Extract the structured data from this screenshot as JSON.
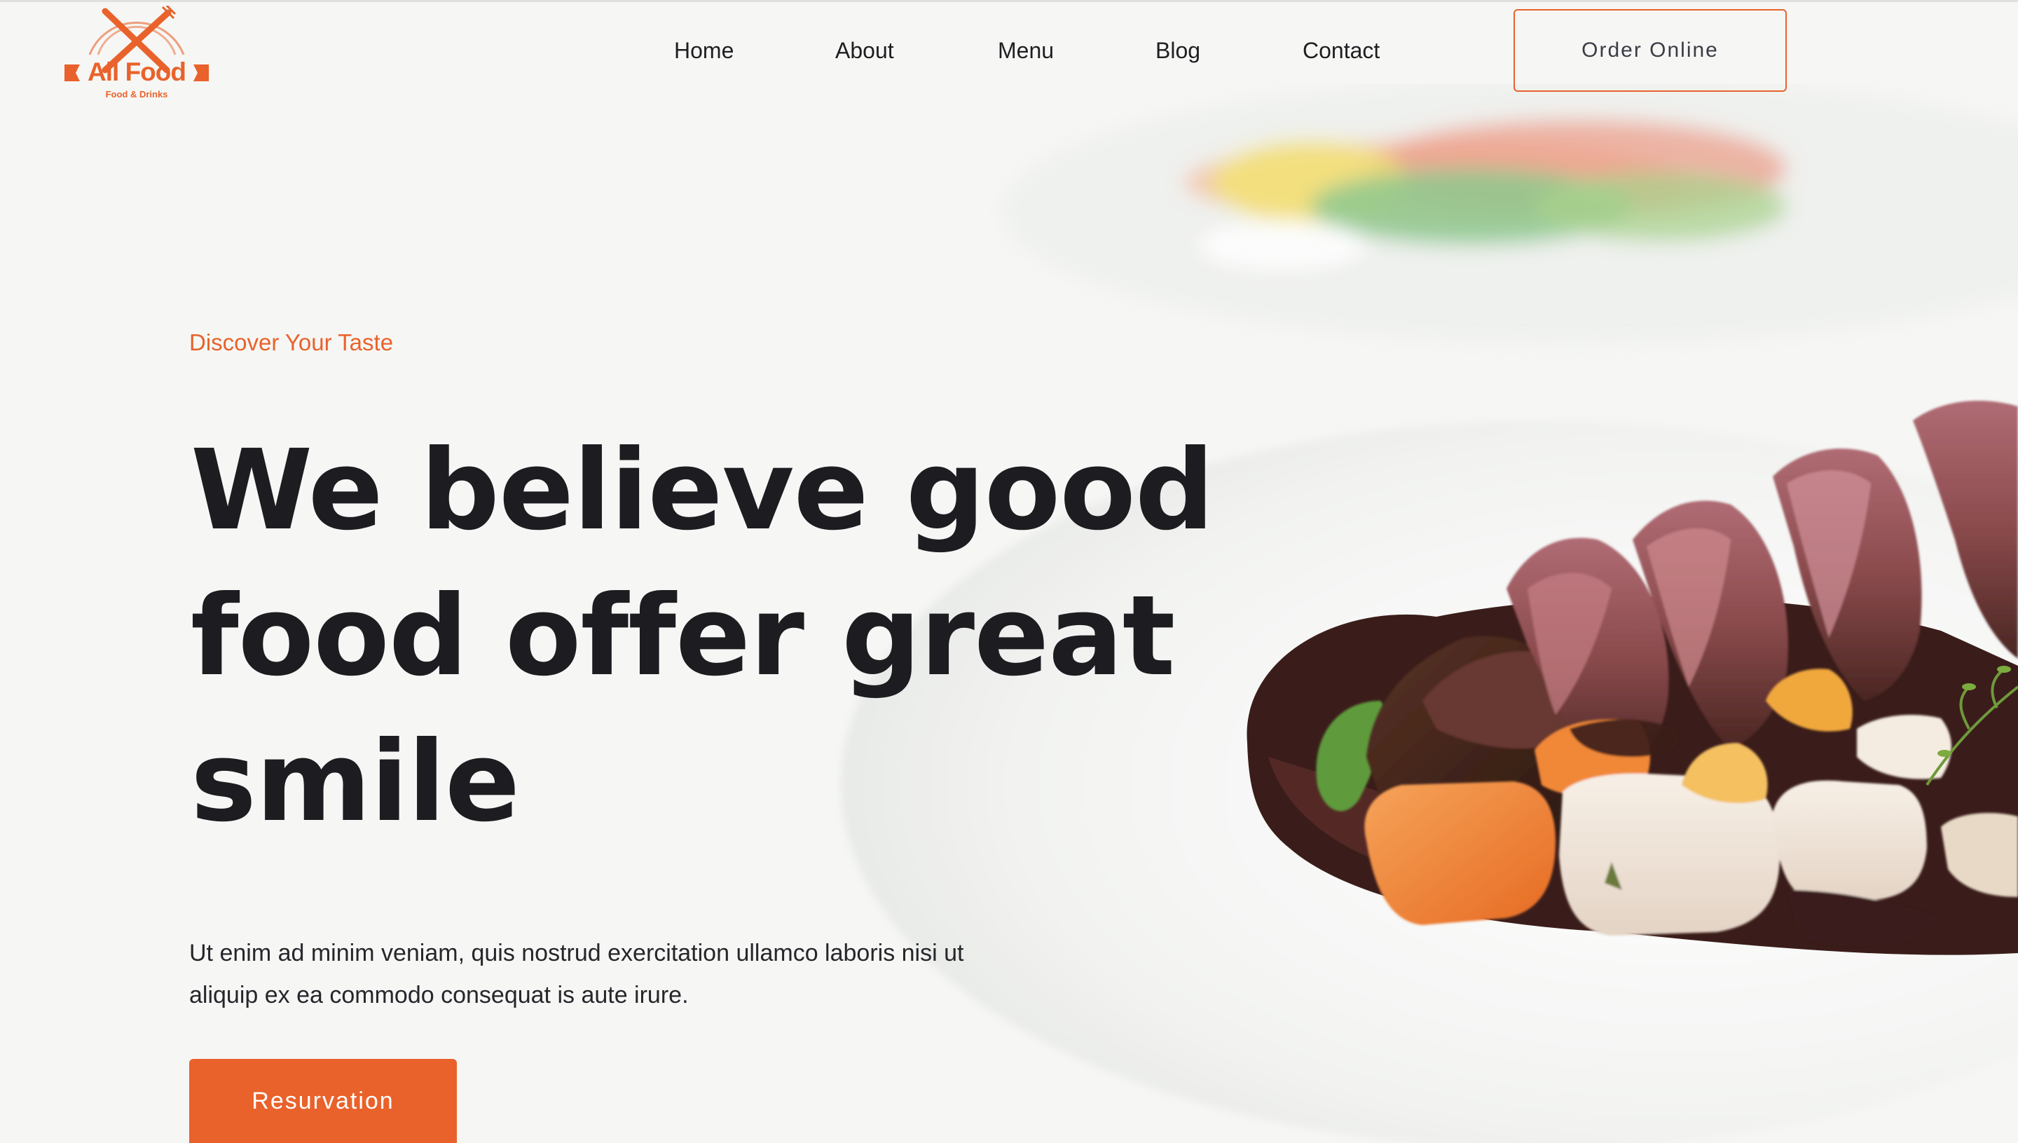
{
  "brand": {
    "name": "All Food",
    "tagline": "Food & Drinks",
    "accent_color": "#e9622b",
    "logo_icon": "crossed-fork-and-knife-icon"
  },
  "nav": {
    "items": [
      {
        "label": "Home"
      },
      {
        "label": "About"
      },
      {
        "label": "Menu"
      },
      {
        "label": "Blog"
      },
      {
        "label": "Contact"
      }
    ],
    "cta_label": "Order Online"
  },
  "hero": {
    "eyebrow": "Discover Your Taste",
    "headline_lines": [
      "We believe good",
      "food offer great",
      "smile"
    ],
    "lead_lines": [
      "Ut enim ad minim veniam, quis nostrud exercitation ullamco laboris nisi ut",
      "aliquip ex ea commodo consequat is aute irure."
    ],
    "button_label": "Resurvation",
    "image": "plated-sliced-beef-with-roasted-vegetables"
  },
  "colors": {
    "text_dark": "#1d1d21",
    "background": "#f6f7f5",
    "button_text": "#ffffff"
  }
}
